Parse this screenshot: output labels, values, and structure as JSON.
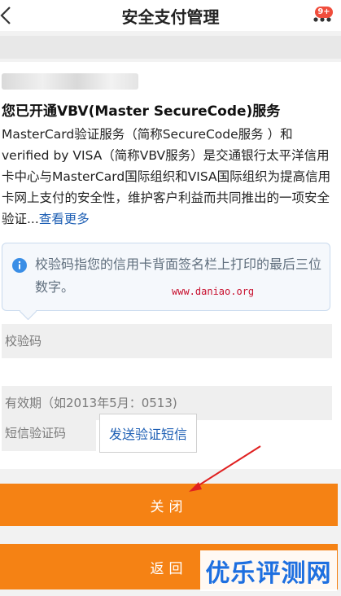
{
  "header": {
    "title": "安全支付管理",
    "badge": "9+",
    "back_icon": "chevron-left-icon",
    "more_icon": "more-dots-icon"
  },
  "card": {
    "service_title": "您已开通VBV(Master SecureCode)服务",
    "description": "MasterCard验证服务（简称SecureCode服务 ）和verified by VISA（简称VBV服务）是交通银行太平洋信用卡中心与MasterCard国际组织和VISA国际组织为提高信用卡网上支付的安全性，维护客户利益而共同推出的一项安全验证...",
    "more_link": "查看更多"
  },
  "tooltip": {
    "text": "校验码指您的信用卡背面签名栏上打印的最后三位数字。",
    "watermark_url": "www.daniao.org",
    "icon": "info-icon"
  },
  "form": {
    "cvv_placeholder": "校验码",
    "expiry_placeholder": "有效期（如2013年5月：0513)",
    "sms_placeholder": "短信验证码",
    "send_sms_label": "发送验证短信"
  },
  "buttons": {
    "close_label": "关闭",
    "back_label": "返回"
  },
  "watermark": {
    "logo_text": "优乐评测网"
  },
  "colors": {
    "accent_orange": "#f58214",
    "link_blue": "#1e5fb4",
    "badge_red": "#f04d3c",
    "annotation_red": "#e02020"
  }
}
